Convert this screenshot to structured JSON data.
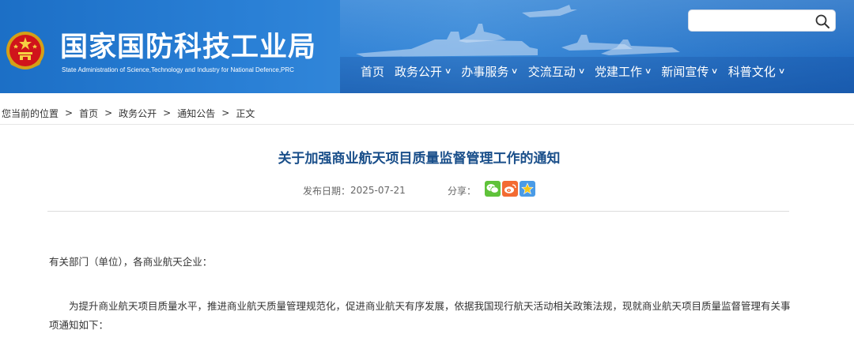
{
  "site": {
    "title": "国家国防科技工业局",
    "subtitle": "State Administration of Science,Technology and Industry for National Defence,PRC"
  },
  "search": {
    "placeholder": ""
  },
  "nav": [
    {
      "label": "首页",
      "has_dropdown": false
    },
    {
      "label": "政务公开",
      "has_dropdown": true
    },
    {
      "label": "办事服务",
      "has_dropdown": true
    },
    {
      "label": "交流互动",
      "has_dropdown": true
    },
    {
      "label": "党建工作",
      "has_dropdown": true
    },
    {
      "label": "新闻宣传",
      "has_dropdown": true
    },
    {
      "label": "科普文化",
      "has_dropdown": true
    }
  ],
  "breadcrumb": {
    "prefix": "您当前的位置",
    "separator": ">",
    "items": [
      "首页",
      "政务公开",
      "通知公告",
      "正文"
    ]
  },
  "article": {
    "title": "关于加强商业航天项目质量监督管理工作的通知",
    "date_label": "发布日期：",
    "date": "2025-07-21",
    "share_label": "分享：",
    "salutation": "有关部门（单位），各商业航天企业：",
    "body": "为提升商业航天项目质量水平，推进商业航天质量管理规范化，促进商业航天有序发展，依据我国现行航天活动相关政策法规，现就商业航天项目质量监督管理有关事项通知如下："
  },
  "colors": {
    "header_blue": "#2a80d6",
    "title_blue": "#1a4f8a",
    "wechat": "#5fc23a",
    "weibo": "#f36b32",
    "qzone": "#4a9be6"
  }
}
